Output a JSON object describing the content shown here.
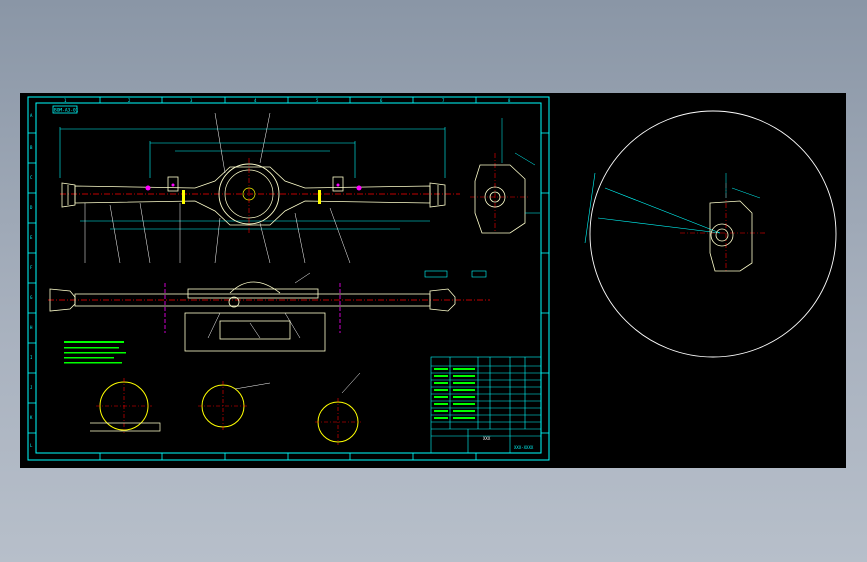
{
  "drawing": {
    "stamp_label": "BOM-A3-01",
    "zones_top": [
      "1",
      "2",
      "3",
      "4",
      "5",
      "6",
      "7",
      "8"
    ],
    "zones_side": [
      "A",
      "B",
      "C",
      "D",
      "E",
      "F",
      "G",
      "H",
      "I",
      "J",
      "K",
      "L"
    ],
    "title_block": {
      "name": "XXX",
      "part_no": "XXX-XXXX"
    }
  },
  "colors": {
    "background": "#000000",
    "frame": "#00ffff",
    "dimension": "#00ffff",
    "centerline": "#ff0000",
    "part_outline": "#ffffcc",
    "circle_view": "#ffffff",
    "highlight": "#ffff00",
    "magenta": "#ff00ff",
    "leader": "#ffffff",
    "green": "#00ff00"
  }
}
